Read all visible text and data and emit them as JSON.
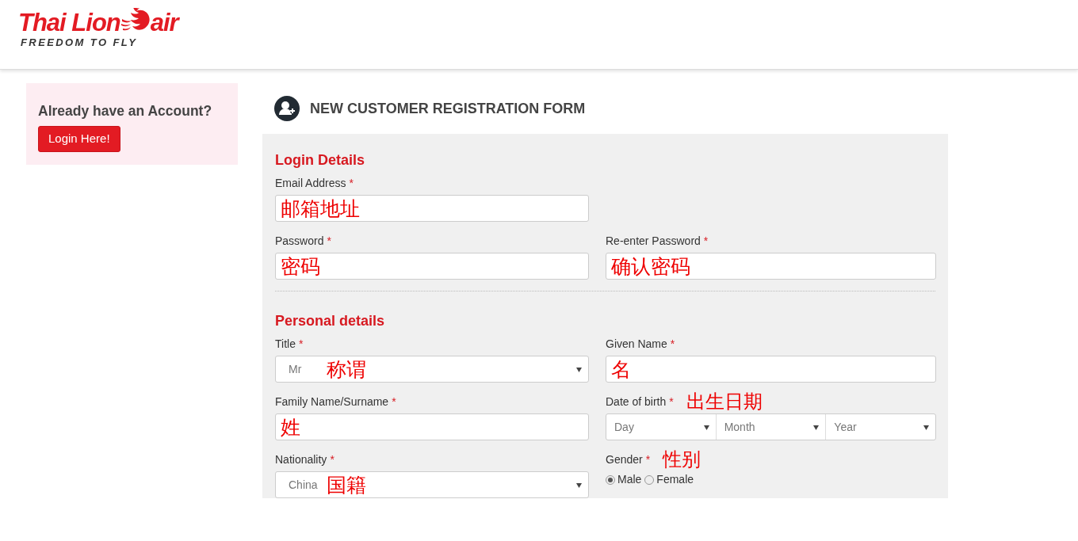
{
  "header": {
    "logo": {
      "name_left": "Thai Lion",
      "name_right": "air",
      "tagline": "FREEDOM TO FLY"
    }
  },
  "login_box": {
    "title": "Already have an Account?",
    "button": "Login Here!"
  },
  "form": {
    "title": "NEW CUSTOMER REGISTRATION FORM",
    "sections": [
      {
        "title": "Login Details",
        "rows": [
          [
            {
              "kind": "text",
              "label": "Email Address",
              "required_mark": "*",
              "note": "邮箱地址"
            }
          ],
          [
            {
              "kind": "text",
              "label": "Password",
              "required_mark": "*",
              "note": "密码"
            },
            {
              "kind": "text",
              "label": "Re-enter Password",
              "required_mark": "*",
              "note": "确认密码"
            }
          ]
        ]
      },
      {
        "title": "Personal details",
        "rows": [
          [
            {
              "kind": "select",
              "label": "Title",
              "required_mark": "*",
              "value": "Mr",
              "note": "称谓"
            },
            {
              "kind": "text",
              "label": "Given Name",
              "required_mark": "*",
              "note": "名"
            }
          ],
          [
            {
              "kind": "text",
              "label": "Family Name/Surname",
              "required_mark": "*",
              "note": "姓"
            },
            {
              "kind": "date",
              "label": "Date of birth",
              "required_mark": "*",
              "label_note": "出生日期",
              "parts": [
                {
                  "value": "Day"
                },
                {
                  "value": "Month"
                },
                {
                  "value": "Year"
                }
              ]
            }
          ],
          [
            {
              "kind": "select",
              "label": "Nationality",
              "required_mark": "*",
              "value": "China",
              "note": "国籍"
            },
            {
              "kind": "radio",
              "label": "Gender",
              "required_mark": "*",
              "label_note": "性别",
              "options": [
                {
                  "label": "Male",
                  "selected": true
                },
                {
                  "label": "Female",
                  "selected": false
                }
              ]
            }
          ]
        ]
      }
    ]
  }
}
